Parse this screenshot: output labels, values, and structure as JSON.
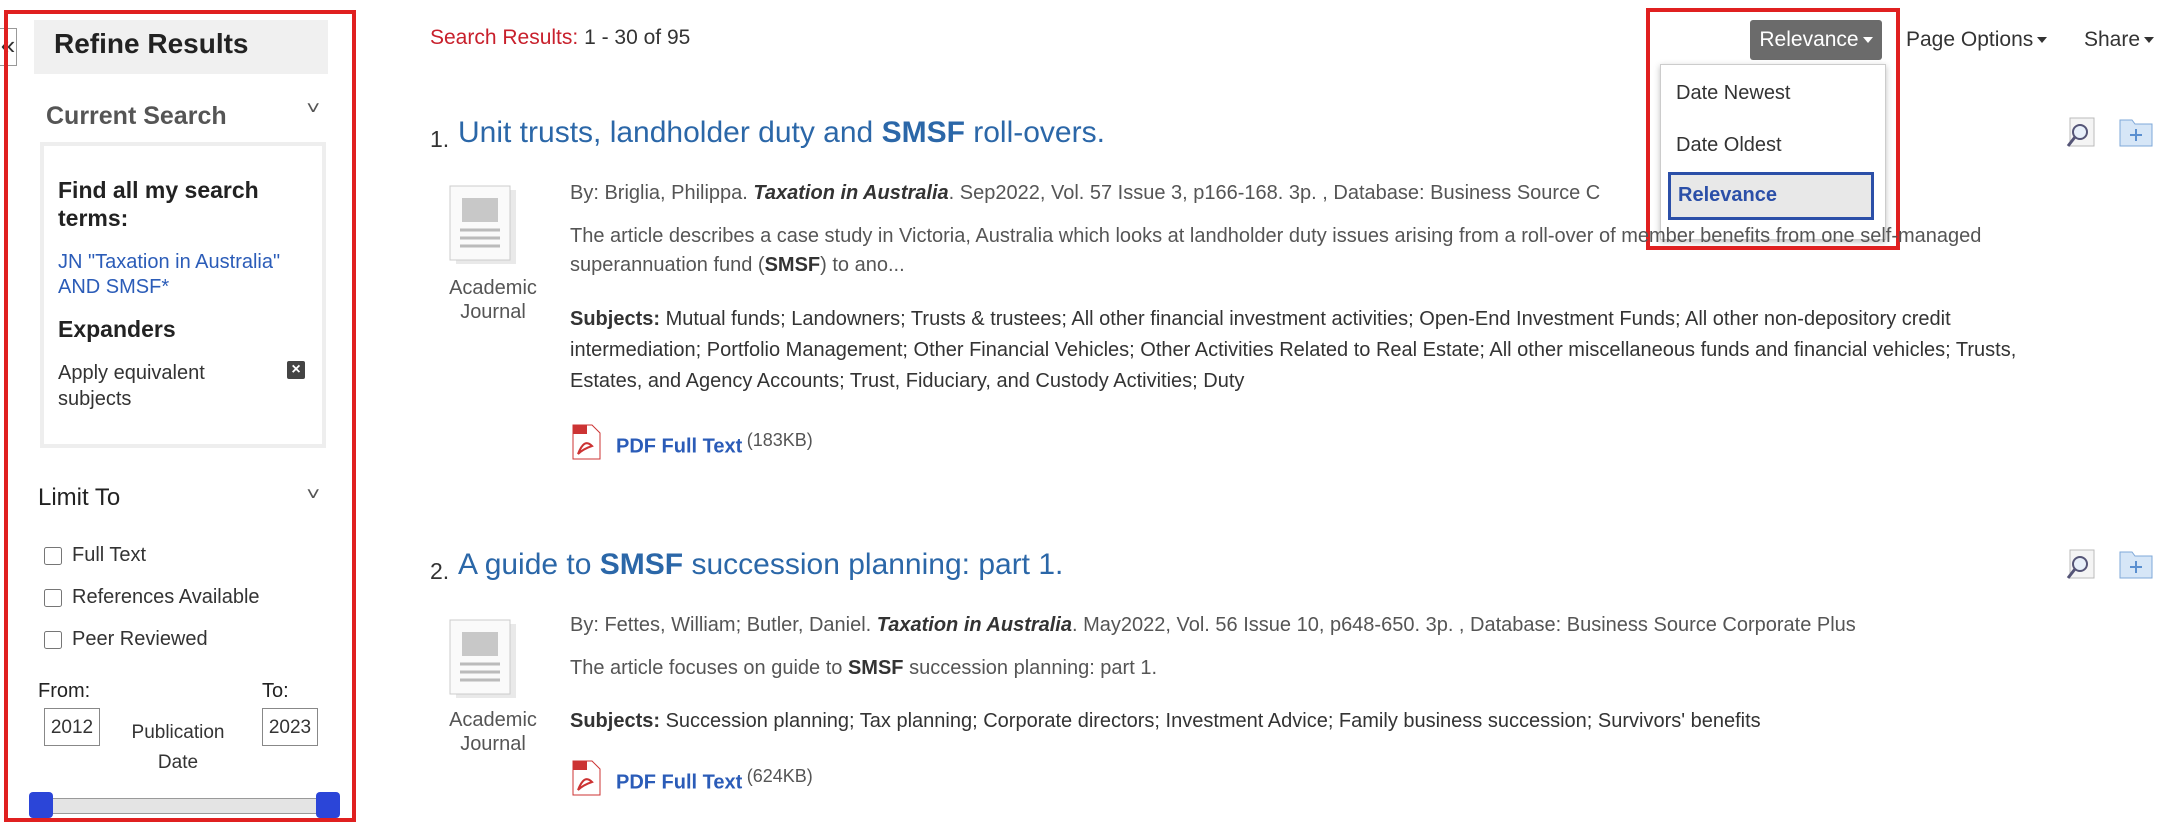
{
  "sidebar": {
    "collapse_glyph": "«",
    "title": "Refine Results",
    "current_search": {
      "title": "Current Search",
      "find_label": "Find all my search terms:",
      "query": "JN \"Taxation in Australia\" AND SMSF*",
      "expanders_label": "Expanders",
      "expander_item": "Apply equivalent subjects",
      "remove_glyph": "×"
    },
    "limit_to": {
      "title": "Limit To",
      "options": [
        {
          "label": "Full Text",
          "checked": false
        },
        {
          "label": "References Available",
          "checked": false
        },
        {
          "label": "Peer Reviewed",
          "checked": false
        }
      ]
    },
    "date_range": {
      "from_label": "From:",
      "to_label": "To:",
      "from_value": "2012",
      "to_value": "2023",
      "caption_line1": "Publication",
      "caption_line2": "Date"
    },
    "chevron": "˅"
  },
  "results_header": {
    "label": "Search Results:",
    "range": "1 - 30 of 95"
  },
  "toolbar": {
    "sort_selected": "Relevance",
    "sort_options": [
      "Date Newest",
      "Date Oldest",
      "Relevance"
    ],
    "page_options": "Page Options",
    "share": "Share"
  },
  "results": [
    {
      "number": "1.",
      "title_pre": "Unit trusts, landholder duty and ",
      "title_bold": "SMSF",
      "title_post": " roll-overs.",
      "type_line1": "Academic",
      "type_line2": "Journal",
      "authors": "By: Briglia, Philippa. ",
      "source": "Taxation in Australia",
      "citation": ". Sep2022, Vol. 57 Issue 3, p166-168. 3p. , Database: Business Source C",
      "abstract_1": "The article describes a case study in Victoria, Australia which looks at landholder duty issues arising from a roll-over of member benefits from one self-managed",
      "abstract_2_pre": "superannuation fund (",
      "abstract_2_bold": "SMSF",
      "abstract_2_post": ") to ano...",
      "subjects_label": "Subjects:",
      "subjects_1": " Mutual funds; Landowners; Trusts & trustees; All other financial investment activities; Open-End Investment Funds; All other non-depository credit",
      "subjects_2": "intermediation; Portfolio Management; Other Financial Vehicles; Other Activities Related to Real Estate; All other miscellaneous funds and financial vehicles; Trusts,",
      "subjects_3": "Estates, and Agency Accounts; Trust, Fiduciary, and Custody Activities; Duty",
      "pdf_label": "PDF Full Text",
      "pdf_size": "(183KB)"
    },
    {
      "number": "2.",
      "title_pre": "A guide to ",
      "title_bold": "SMSF",
      "title_post": " succession planning: part 1.",
      "type_line1": "Academic",
      "type_line2": "Journal",
      "authors": "By: Fettes, William; Butler, Daniel. ",
      "source": "Taxation in Australia",
      "citation": ". May2022, Vol. 56 Issue 10, p648-650. 3p. , Database: Business Source Corporate Plus",
      "abstract_1_pre": "The article focuses on guide to ",
      "abstract_1_bold": "SMSF",
      "abstract_1_post": " succession planning: part 1.",
      "subjects_label": "Subjects:",
      "subjects_1": " Succession planning; Tax planning; Corporate directors; Investment Advice; Family business succession; Survivors' benefits",
      "pdf_label": "PDF Full Text",
      "pdf_size": "(624KB)"
    }
  ],
  "colors": {
    "highlight_frame": "#e02020",
    "link_blue": "#2b67a8",
    "results_red": "#c8202c",
    "slider_handle": "#2b45d8"
  },
  "icons": [
    "collapse-icon",
    "chevron-down-icon",
    "remove-icon",
    "document-icon",
    "pdf-icon",
    "preview-icon",
    "add-to-folder-icon",
    "caret-down-icon"
  ]
}
